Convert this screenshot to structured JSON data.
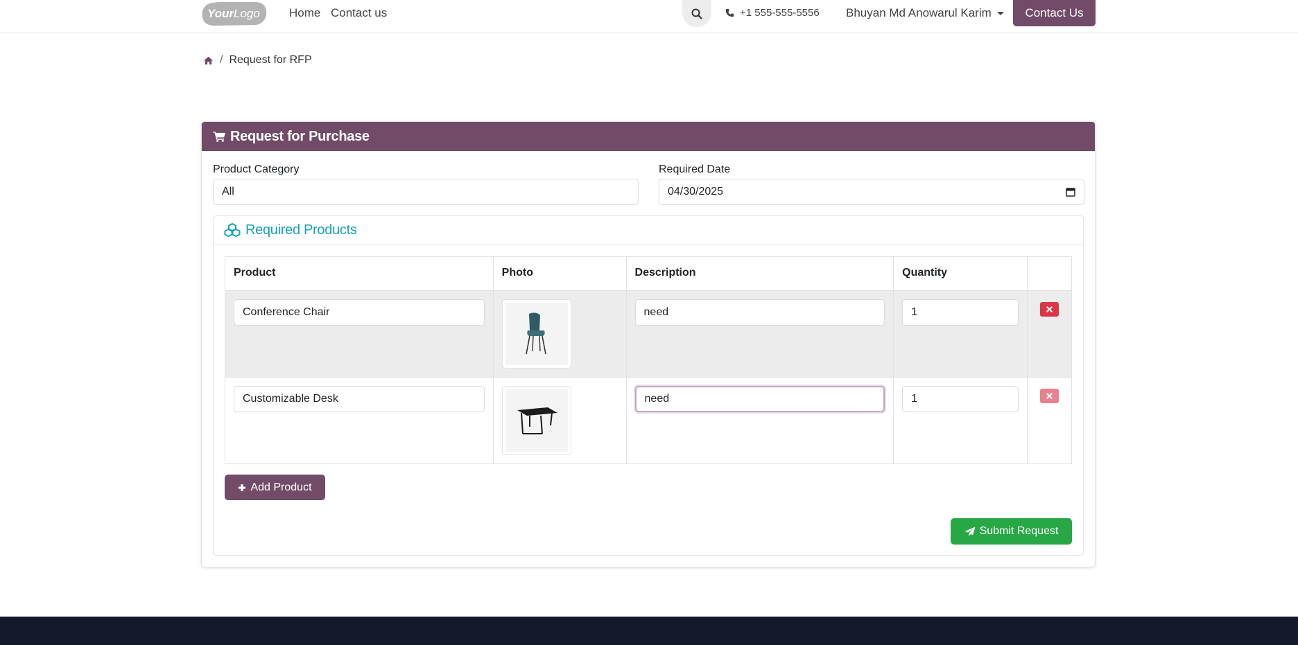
{
  "header": {
    "logo_text": "YourLogo",
    "nav": [
      "Home",
      "Contact us"
    ],
    "phone": "+1 555-555-5556",
    "user": "Bhuyan Md Anowarul Karim",
    "contact_button": "Contact Us"
  },
  "breadcrumb": {
    "current": "Request for RFP"
  },
  "card": {
    "title": "Request for Purchase",
    "category_label": "Product Category",
    "category_value": "All",
    "date_label": "Required Date",
    "date_value": "04/30/2025",
    "products_title": "Required Products",
    "columns": [
      "Product",
      "Photo",
      "Description",
      "Quantity",
      ""
    ],
    "rows": [
      {
        "product": "Conference Chair",
        "photo": "chair-photo",
        "description": "need",
        "quantity": "1"
      },
      {
        "product": "Customizable Desk",
        "photo": "desk-photo",
        "description": "need",
        "quantity": "1"
      }
    ],
    "add_button": "Add Product",
    "submit_button": "Submit Request"
  },
  "colors": {
    "brand": "#714b67",
    "info": "#17a2b8",
    "success": "#28a745",
    "danger": "#dc3545",
    "footer": "#141a2b"
  }
}
